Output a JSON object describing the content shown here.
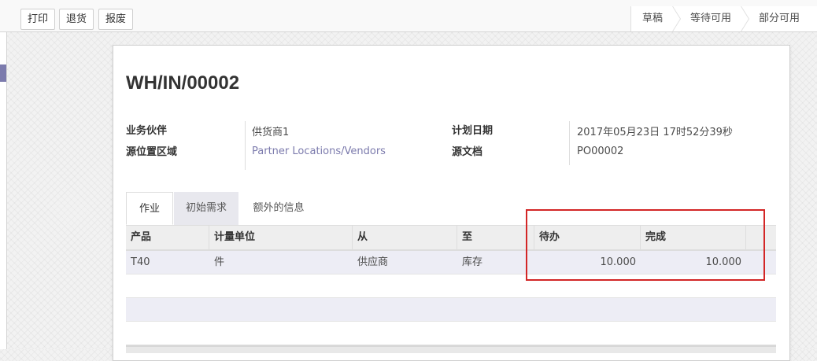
{
  "toolbar": {
    "print": "打印",
    "return": "退货",
    "scrap": "报废"
  },
  "status_stages": [
    "草稿",
    "等待可用",
    "部分可用"
  ],
  "record": {
    "name": "WH/IN/00002",
    "partner_label": "业务伙伴",
    "partner_value": "供货商1",
    "source_location_label": "源位置区域",
    "source_location_value": "Partner Locations/Vendors",
    "scheduled_date_label": "计划日期",
    "scheduled_date_value": "2017年05月23日 17时52分39秒",
    "source_document_label": "源文档",
    "source_document_value": "PO00002"
  },
  "tabs": [
    "作业",
    "初始需求",
    "额外的信息"
  ],
  "grid": {
    "headers": [
      "产品",
      "计量单位",
      "从",
      "至",
      "待办",
      "完成"
    ],
    "rows": [
      [
        "T40",
        "件",
        "供应商",
        "库存",
        "10.000",
        "10.000"
      ]
    ]
  },
  "colors": {
    "accent": "#7c7bad",
    "highlight_border": "#d32626"
  }
}
